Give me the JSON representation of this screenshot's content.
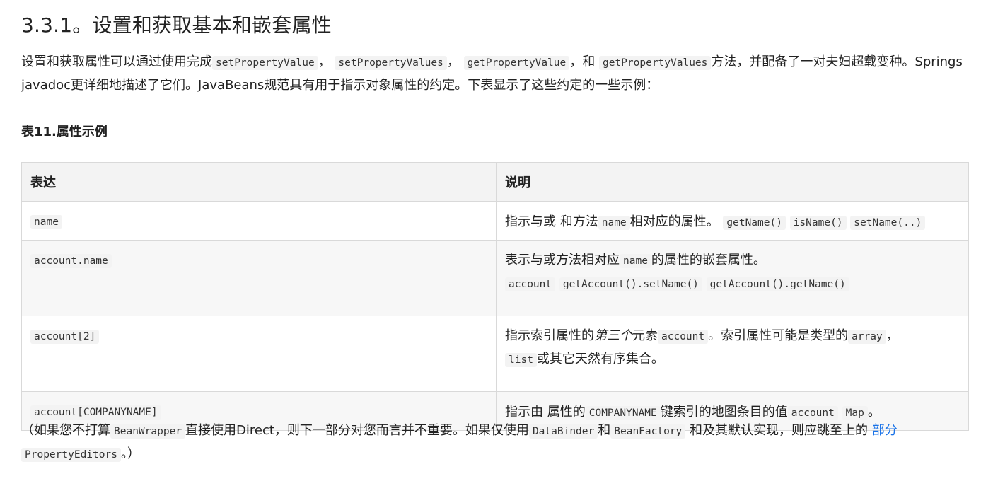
{
  "heading": "3.3.1。设置和获取基本和嵌套属性",
  "intro": {
    "t1": "设置和获取属性可以通过使用完成",
    "c1": "setPropertyValue",
    "t2": "，",
    "c2": "setPropertyValues",
    "t3": "，",
    "c3": "getPropertyValue",
    "t4": "，和",
    "c4": "getPropertyValues",
    "t5": "方法，并配备了一对夫妇超载变种。Springs javadoc更详细地描述了它们。JavaBeans规范具有用于指示对象属性的约定。下表显示了这些约定的一些示例："
  },
  "caption": "表11.属性示例",
  "table": {
    "headers": [
      "表达",
      "说明"
    ],
    "rows": [
      {
        "expr": "name",
        "d_t1": "指示与或 和方法",
        "d_c1": "name",
        "d_t2": "相对应的属性。",
        "d_c2": "getName()",
        "d_c3": "isName()",
        "d_c4": "setName(..)"
      },
      {
        "expr": "account.name",
        "d_t1": "表示与或方法相对应",
        "d_c1": "name",
        "d_t2": "的属性的嵌套属性。",
        "d_c2": "account",
        "d_c3": "getAccount().setName()",
        "d_c4": "getAccount().getName()"
      },
      {
        "expr": "account[2]",
        "d_t1": "指示索引属性的",
        "d_em": "第三个",
        "d_t2": "元素",
        "d_c1": "account",
        "d_t3": "。索引属性可能是类型的",
        "d_c2": "array",
        "d_t4": "，",
        "d_c3": "list",
        "d_t5": "或其它天然有序集合。"
      },
      {
        "expr": "account[COMPANYNAME]",
        "d_t1": "指示由 属性的",
        "d_c1": "COMPANYNAME",
        "d_t2": "键索引的地图条目的值",
        "d_c2": "account",
        "d_c3": "Map",
        "d_t3": "。"
      }
    ]
  },
  "outro": {
    "t1": "（如果您不打算",
    "c1": "BeanWrapper",
    "t2": "直接使用Direct，则下一部分对您而言并不重要。如果仅使用",
    "c2": "DataBinder",
    "t3": "和",
    "c3": "BeanFactory",
    "t4": "和及其默认实现，则应跳至上的",
    "link": "部分",
    "c4": "PropertyEditors",
    "t5": "。）"
  },
  "colors": {
    "link": "#1a73e8",
    "code_bg": "#f3f3f3",
    "header_bg": "#f3f3f3",
    "border": "#d9d9d9"
  }
}
